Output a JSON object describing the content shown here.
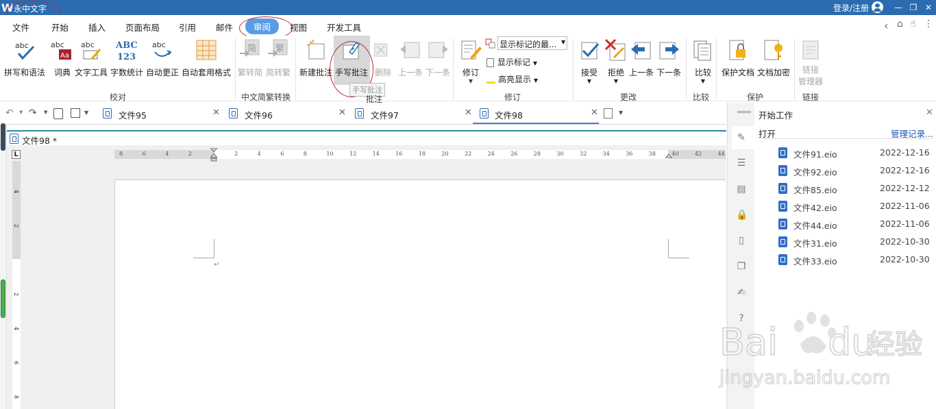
{
  "app": {
    "title": "永中文字",
    "login": "登录/注册"
  },
  "menu": [
    "文件",
    "开始",
    "插入",
    "页面布局",
    "引用",
    "邮件",
    "审阅",
    "视图",
    "开发工具"
  ],
  "ribbon": {
    "buttons": {
      "spell": "拼写和语法",
      "dict": "词典",
      "texttool": "文字工具",
      "wordcount": "字数统计",
      "autocorrect": "自动更正",
      "autoformat": "自动套用格式",
      "t2s": "繁转简",
      "s2t": "简转繁",
      "newcomment": "新建批注",
      "handcomment": "手写批注",
      "delete": "删除",
      "prev1": "上一条",
      "next1": "下一条",
      "track": "修订",
      "markup_select": "显示标记的最...",
      "show_markup": "显示标记",
      "highlight": "高亮显示",
      "accept": "接受",
      "reject": "拒绝",
      "prev2": "上一条",
      "next2": "下一条",
      "compare": "比较",
      "protect": "保护文档",
      "encrypt": "文档加密",
      "link_mgr_1": "链接",
      "link_mgr_2": "管理器",
      "abc": "ABC",
      "n123": "123",
      "jian": "简",
      "fan": "繁"
    },
    "groups": {
      "proof": "校对",
      "cn": "中文简繁转换",
      "comment": "批注",
      "revision": "修订",
      "change": "更改",
      "compare": "比较",
      "protect": "保护",
      "link": "链接"
    },
    "tooltip": "手写批注"
  },
  "tabs": [
    {
      "label": "文件95"
    },
    {
      "label": "文件96"
    },
    {
      "label": "文件97"
    },
    {
      "label": "文件98"
    }
  ],
  "doc": {
    "title": "文件98 *",
    "ruler_corner": "L"
  },
  "ruler_h": [
    "8",
    "6",
    "4",
    "2",
    "2",
    "4",
    "6",
    "8",
    "10",
    "12",
    "14",
    "16",
    "18",
    "20",
    "22",
    "24",
    "26",
    "28",
    "30",
    "32",
    "34",
    "36",
    "38",
    "40",
    "42",
    "44"
  ],
  "ruler_v": [
    "4",
    "2",
    "2",
    "4",
    "6",
    "8"
  ],
  "sidepanel": {
    "title": "开始工作",
    "open": "打开",
    "manage": "管理记录...",
    "files": [
      {
        "name": "文件91.eio",
        "date": "2022-12-16"
      },
      {
        "name": "文件92.eio",
        "date": "2022-12-16"
      },
      {
        "name": "文件85.eio",
        "date": "2022-12-12"
      },
      {
        "name": "文件42.eio",
        "date": "2022-11-06"
      },
      {
        "name": "文件44.eio",
        "date": "2022-11-06"
      },
      {
        "name": "文件31.eio",
        "date": "2022-10-30"
      },
      {
        "name": "文件33.eio",
        "date": "2022-10-30"
      }
    ]
  },
  "watermark": {
    "brand": "Bai",
    "brand2": "du",
    "cn": "经验",
    "url": "jingyan.baidu.com"
  }
}
